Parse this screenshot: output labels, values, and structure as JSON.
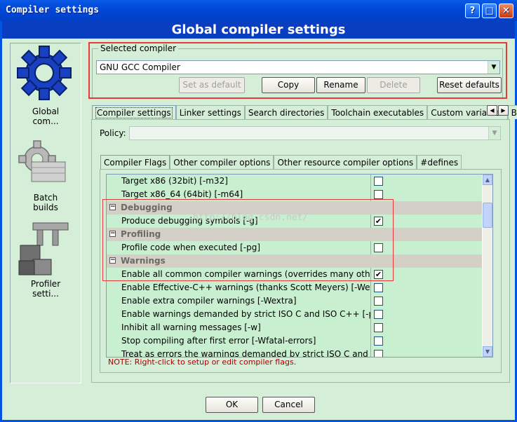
{
  "window": {
    "title": "Compiler settings",
    "banner": "Global compiler settings"
  },
  "sidebar": {
    "items": [
      {
        "label_line1": "Global",
        "label_line2": "com...",
        "icon": "gear-icon"
      },
      {
        "label_line1": "Batch",
        "label_line2": "builds",
        "icon": "batch-gear-icon"
      },
      {
        "label_line1": "Profiler",
        "label_line2": "setti...",
        "icon": "profiler-icon"
      }
    ]
  },
  "selected_compiler": {
    "legend": "Selected compiler",
    "value": "GNU GCC Compiler",
    "buttons": {
      "set_default": "Set as default",
      "copy": "Copy",
      "rename": "Rename",
      "delete": "Delete",
      "reset": "Reset defaults"
    }
  },
  "main_tabs": [
    "Compiler settings",
    "Linker settings",
    "Search directories",
    "Toolchain executables",
    "Custom variables",
    "Bu"
  ],
  "policy": {
    "label": "Policy:",
    "value": ""
  },
  "sub_tabs": [
    "Compiler Flags",
    "Other compiler options",
    "Other resource compiler options",
    "#defines"
  ],
  "flags": [
    {
      "type": "item",
      "label": "Target x86 (32bit)  [-m32]",
      "checked": false
    },
    {
      "type": "item",
      "label": "Target x86_64 (64bit)  [-m64]",
      "checked": false
    },
    {
      "type": "cat",
      "label": "Debugging"
    },
    {
      "type": "item",
      "label": "Produce debugging symbols  [-g]",
      "checked": true
    },
    {
      "type": "cat",
      "label": "Profiling"
    },
    {
      "type": "item",
      "label": "Profile code when executed  [-pg]",
      "checked": false
    },
    {
      "type": "cat",
      "label": "Warnings"
    },
    {
      "type": "item",
      "label": "Enable all common compiler warnings (overrides many other settings)",
      "checked": true
    },
    {
      "type": "item",
      "label": "Enable Effective-C++ warnings (thanks Scott Meyers)  [-Weffc++]",
      "checked": false
    },
    {
      "type": "item",
      "label": "Enable extra compiler warnings  [-Wextra]",
      "checked": false
    },
    {
      "type": "item",
      "label": "Enable warnings demanded by strict ISO C and ISO C++  [-pedantic]",
      "checked": false
    },
    {
      "type": "item",
      "label": "Inhibit all warning messages  [-w]",
      "checked": false
    },
    {
      "type": "item",
      "label": "Stop compiling after first error  [-Wfatal-errors]",
      "checked": false
    },
    {
      "type": "item",
      "label": "Treat as errors the warnings demanded by strict ISO C and ISO C++",
      "checked": false
    }
  ],
  "note": "NOTE: Right-click to setup or edit compiler flags.",
  "watermark": "http://blog.csdn.net/",
  "footer": {
    "ok": "OK",
    "cancel": "Cancel"
  },
  "check_mark": "✔",
  "cat_sign": "−"
}
